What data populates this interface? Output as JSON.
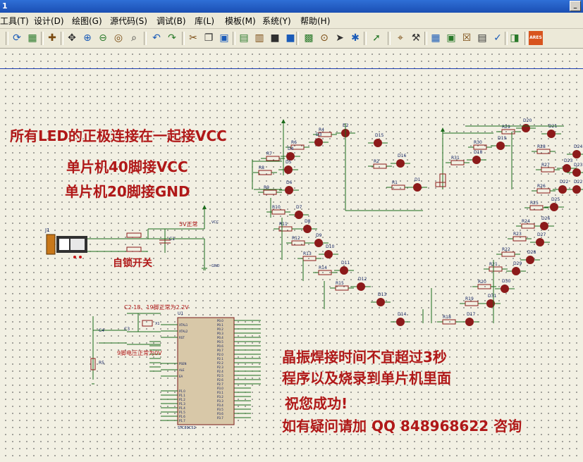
{
  "window": {
    "title_fragment": "1"
  },
  "menu": [
    "工具(T)",
    "设计(D)",
    "绘图(G)",
    "源代码(S)",
    "调试(B)",
    "库(L)",
    "模板(M)",
    "系统(Y)",
    "帮助(H)"
  ],
  "toolbar": {
    "icons": [
      "refresh-icon",
      "grid-icon",
      "origin-icon",
      "pan-icon",
      "zoom-in-icon",
      "zoom-out-icon",
      "zoom-all-icon",
      "zoom-area-icon",
      "undo-icon",
      "redo-icon",
      "cut-icon",
      "copy-icon",
      "paste-icon",
      "block-copy-icon",
      "block-move-icon",
      "block-rotate-icon",
      "block-delete-icon",
      "pick-device-icon",
      "make-device-icon",
      "packaging-icon",
      "decompose-icon",
      "wire-autoroute-icon",
      "search-icon",
      "property-assign-icon",
      "design-explorer-icon",
      "new-sheet-icon",
      "remove-sheet-icon",
      "bom-icon",
      "electrical-check-icon",
      "netlist-to-ares-icon"
    ],
    "ares_label": "ARES"
  },
  "notes": {
    "led_anode": "所有LED的正极连接在一起接VCC",
    "pin40": "单片机40脚接VCC",
    "pin20": "单片机20脚接GND",
    "self_lock": "自锁开关",
    "crystal_time": "晶振焊接时间不宜超过3秒",
    "program": "程序以及烧录到单片机里面",
    "success": "祝您成功!",
    "contact": "如有疑问请加 QQ 848968622 咨询",
    "pin9": "9脚电压正常为0V",
    "c2_voltage": "C2 18、19脚正常为2.2V",
    "supply": "5V正常"
  },
  "schematic": {
    "j1_label": "J1",
    "c1_label": "C1",
    "u1_label": "U1",
    "mcu_part": "STC89C52",
    "c4_label": "C4",
    "r5_label": "R5",
    "c3_label": "C3",
    "x1_label": "X1",
    "vcc_net": "VCC",
    "gnd_net": "GND",
    "resistors_left": [
      "R4",
      "R6",
      "R7",
      "R8",
      "R9",
      "R10",
      "R11",
      "R12",
      "R13",
      "R14",
      "R15"
    ],
    "resistors_mid": [
      "R2",
      "R1"
    ],
    "resistors_right": [
      "R29",
      "R30",
      "R31",
      "R28",
      "R27",
      "R26",
      "R25",
      "R24",
      "R23",
      "R22",
      "R21",
      "R20",
      "R19",
      "R18"
    ],
    "leds_left": [
      "D2",
      "D3",
      "D4",
      "D5",
      "D6",
      "D7",
      "D8",
      "D9",
      "D10",
      "D11",
      "D12",
      "D13",
      "D14",
      "D15",
      "D16",
      "D1"
    ],
    "leds_right": [
      "D20",
      "D19",
      "D18",
      "D17",
      "D21",
      "D22",
      "D23",
      "D24",
      "D25",
      "D26",
      "D27",
      "D28",
      "D29",
      "D30",
      "D31"
    ],
    "mcu_left_pins": [
      "XTAL1",
      "XTAL2",
      "RST",
      "PSEN",
      "ALE",
      "EA",
      "P1.0",
      "P1.1",
      "P1.2",
      "P1.3",
      "P1.4",
      "P1.5",
      "P1.6",
      "P1.7"
    ],
    "mcu_right_pins": [
      "P0.0",
      "P0.1",
      "P0.2",
      "P0.3",
      "P0.4",
      "P0.5",
      "P0.6",
      "P0.7",
      "P2.0",
      "P2.1",
      "P2.2",
      "P2.3",
      "P2.4",
      "P2.5",
      "P2.6",
      "P2.7",
      "P3.0",
      "P3.1",
      "P3.2",
      "P3.3",
      "P3.4",
      "P3.5",
      "P3.6",
      "P3.7"
    ]
  },
  "colors": {
    "note_red": "#b01818",
    "wire": "#1b6b1b",
    "part": "#8b1a1a",
    "grid_bg": "#f2f0e3"
  }
}
